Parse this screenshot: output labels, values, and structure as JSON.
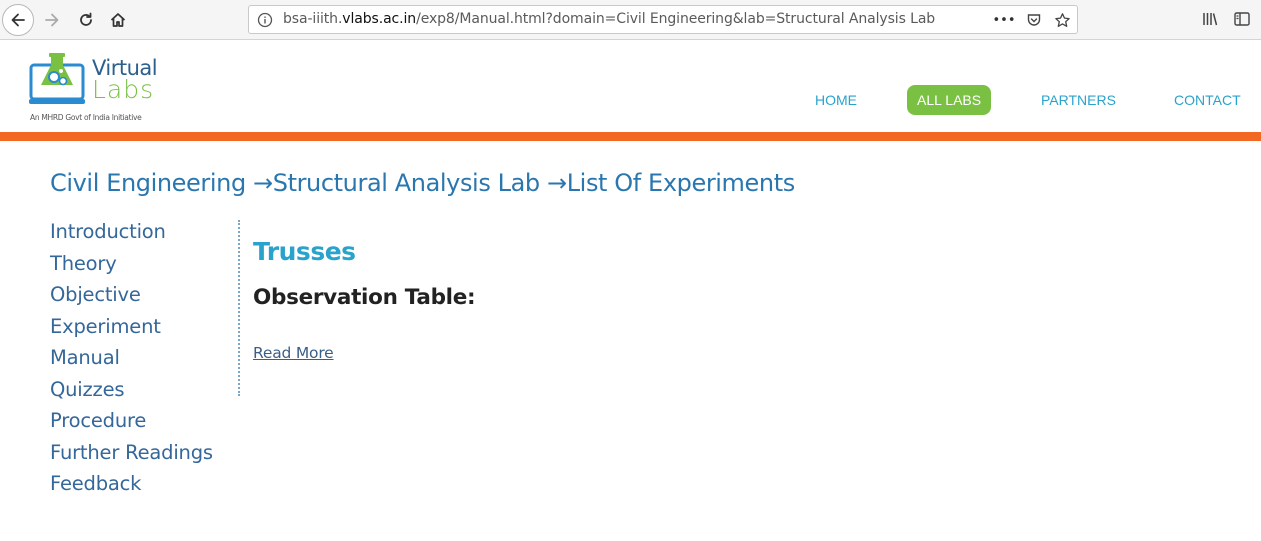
{
  "browser": {
    "url_prefix": "bsa-iiith.",
    "url_domain": "vlabs.ac.in",
    "url_path": "/exp8/Manual.html?domain=Civil Engineering&lab=Structural Analysis Lab",
    "more_label": "•••"
  },
  "site": {
    "logo_word1": "Virtual",
    "logo_word2": "Labs",
    "logo_tagline": "An MHRD Govt of India Initiative",
    "nav": {
      "home": "HOME",
      "all_labs": "ALL LABS",
      "partners": "PARTNERS",
      "contact": "CONTACT"
    },
    "colors": {
      "accent_blue": "#2aa3cc",
      "green": "#7ac143",
      "orange": "#f26722"
    }
  },
  "breadcrumb": "Civil Engineering →Structural Analysis Lab →List Of Experiments",
  "sidebar": {
    "items": [
      {
        "label": "Introduction"
      },
      {
        "label": "Theory"
      },
      {
        "label": "Objective"
      },
      {
        "label": "Experiment"
      },
      {
        "label": "Manual"
      },
      {
        "label": "Quizzes"
      },
      {
        "label": "Procedure"
      },
      {
        "label": "Further Readings"
      },
      {
        "label": "Feedback"
      }
    ]
  },
  "main": {
    "experiment_title": "Trusses",
    "section_title": "Observation Table:",
    "read_more": "Read More"
  }
}
